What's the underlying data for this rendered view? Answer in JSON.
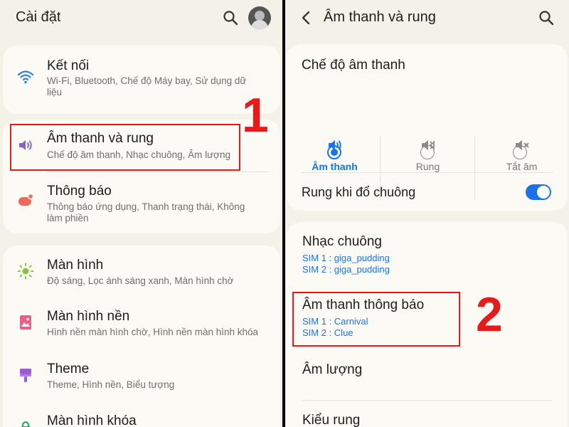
{
  "left": {
    "title": "Cài đặt",
    "items": [
      {
        "title": "Kết nối",
        "subtitle": "Wi-Fi, Bluetooth, Chế độ Máy bay, Sử dụng dữ liệu"
      },
      {
        "title": "Âm thanh và rung",
        "subtitle": "Chế độ âm thanh, Nhạc chuông, Âm lượng"
      },
      {
        "title": "Thông báo",
        "subtitle": "Thông báo ứng dụng, Thanh trạng thái, Không làm phiền"
      },
      {
        "title": "Màn hình",
        "subtitle": "Độ sáng, Lọc ánh sáng xanh, Màn hình chờ"
      },
      {
        "title": "Màn hình nền",
        "subtitle": "Hình nền màn hình chờ, Hình nền màn hình khóa"
      },
      {
        "title": "Theme",
        "subtitle": "Theme, Hình nền, Biểu tượng"
      },
      {
        "title": "Màn hình khóa",
        "subtitle": ""
      }
    ],
    "annotation": "1"
  },
  "right": {
    "title": "Âm thanh và rung",
    "sound_mode_title": "Chế độ âm thanh",
    "modes": [
      {
        "label": "Âm thanh",
        "selected": true
      },
      {
        "label": "Rung",
        "selected": false
      },
      {
        "label": "Tắt âm",
        "selected": false
      }
    ],
    "vibrate_while_ringing": {
      "label": "Rung khi đổ chuông",
      "enabled": true
    },
    "ringtone": {
      "title": "Nhạc chuông",
      "sim1": "SIM 1 : giga_pudding",
      "sim2": "SIM 2 : giga_pudding"
    },
    "notification_sound": {
      "title": "Âm thanh thông báo",
      "sim1": "SIM 1 : Carnival",
      "sim2": "SIM 2 : Clue"
    },
    "volume": {
      "title": "Âm lượng"
    },
    "vibration_pattern": {
      "title": "Kiểu rung"
    },
    "annotation": "2"
  },
  "colors": {
    "accent": "#1a73e8",
    "annotation": "#e51b1b",
    "background": "#f4f1e9",
    "card": "#fbfaf4"
  }
}
